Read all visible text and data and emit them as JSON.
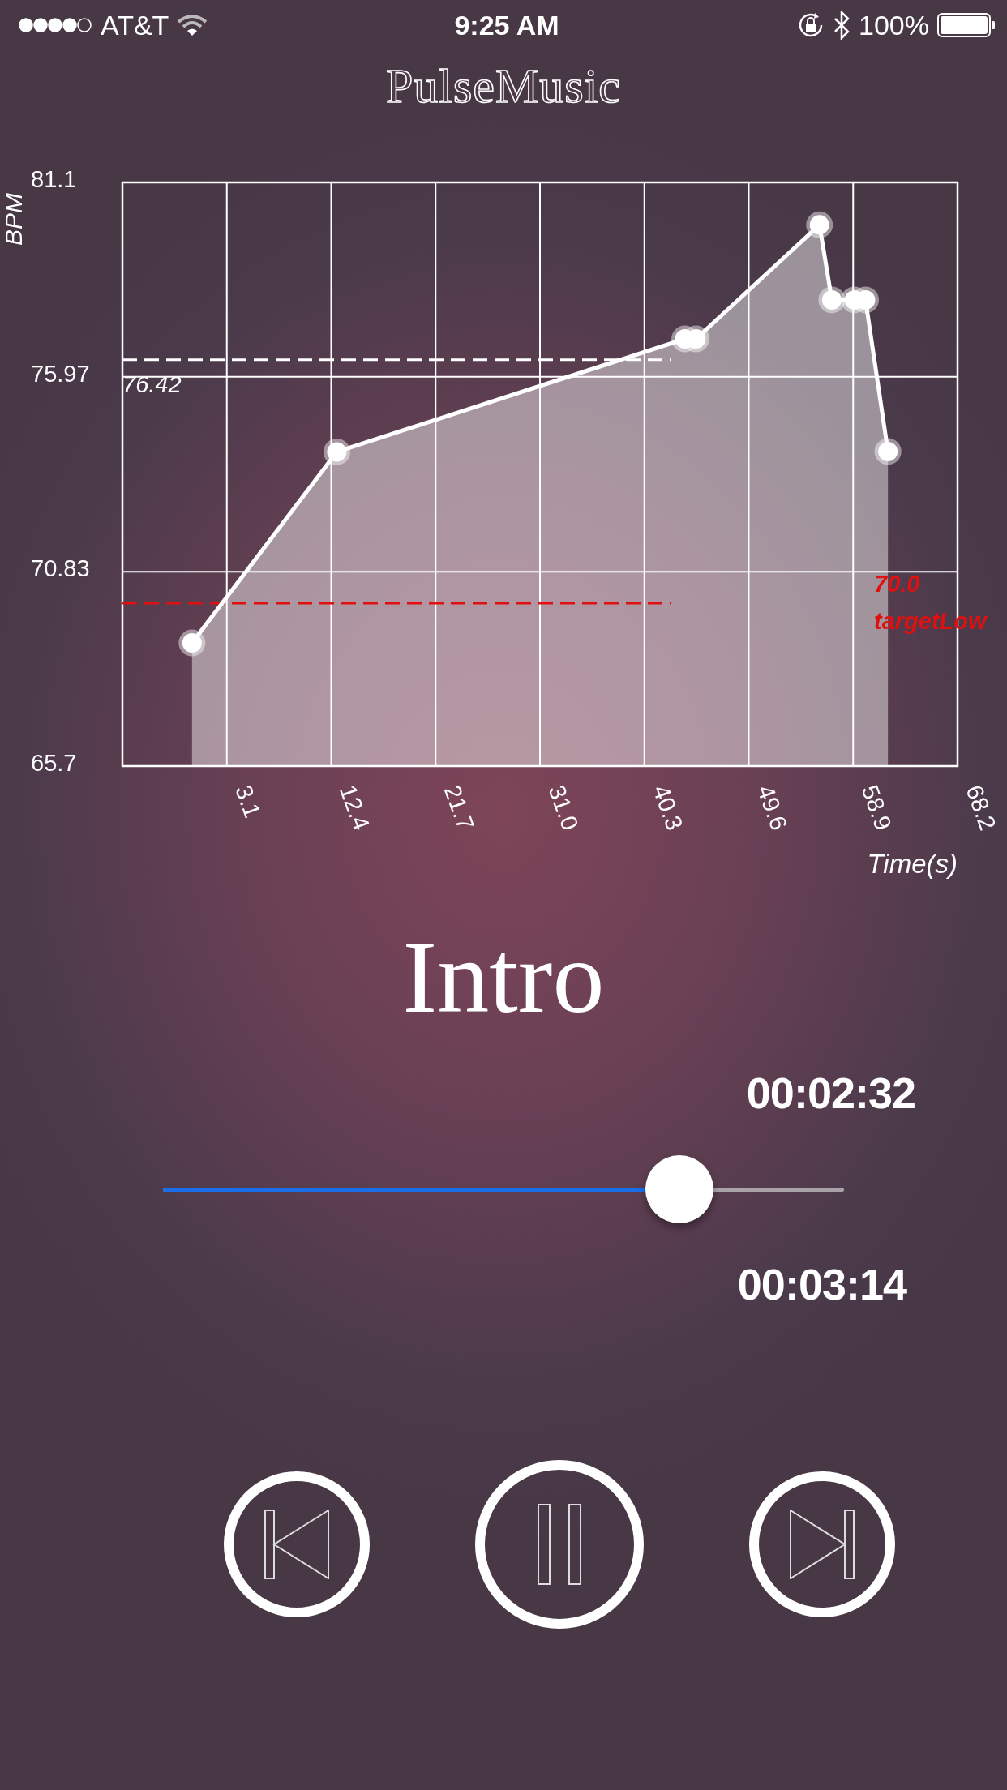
{
  "status_bar": {
    "carrier": "AT&T",
    "time": "9:25 AM",
    "battery": "100%"
  },
  "app_title": "PulseMusic",
  "chart": {
    "chart_data": {
      "type": "area",
      "ylabel": "BPM",
      "xlabel": "Time(s)",
      "grid": true,
      "xlim": [
        -6.2,
        68.2
      ],
      "ylim": [
        65.7,
        81.1
      ],
      "yticks": [
        65.7,
        70.83,
        75.97,
        81.1
      ],
      "xticks": [
        3.1,
        12.4,
        21.7,
        {
          "value": 31,
          "label": "31.0"
        },
        40.3,
        49.6,
        58.9,
        68.2
      ],
      "x": [
        0.0,
        12.9,
        43.9,
        44.9,
        55.9,
        57.0,
        59.0,
        60.0,
        62.0
      ],
      "series": [
        {
          "color": "#ffffff",
          "values": [
            68.95,
            73.99,
            76.97,
            76.97,
            79.98,
            78.0,
            78.0,
            78.0,
            74.0
          ]
        }
      ],
      "ref_lines": [
        {
          "axis": "y",
          "value": 76.42,
          "label": "76.42",
          "color": "#ffffff"
        },
        {
          "axis": "y",
          "value": 70.0,
          "label": "70.0",
          "color": "#e01010"
        }
      ],
      "annotations": [
        "targetLow"
      ]
    }
  },
  "track_title": "Intro",
  "elapsed": "00:02:32",
  "progress": {
    "level": 0.758
  },
  "duration": "00:03:14",
  "controls": [
    {
      "kind": "previous"
    },
    {
      "kind": "pause"
    },
    {
      "kind": "next"
    }
  ]
}
